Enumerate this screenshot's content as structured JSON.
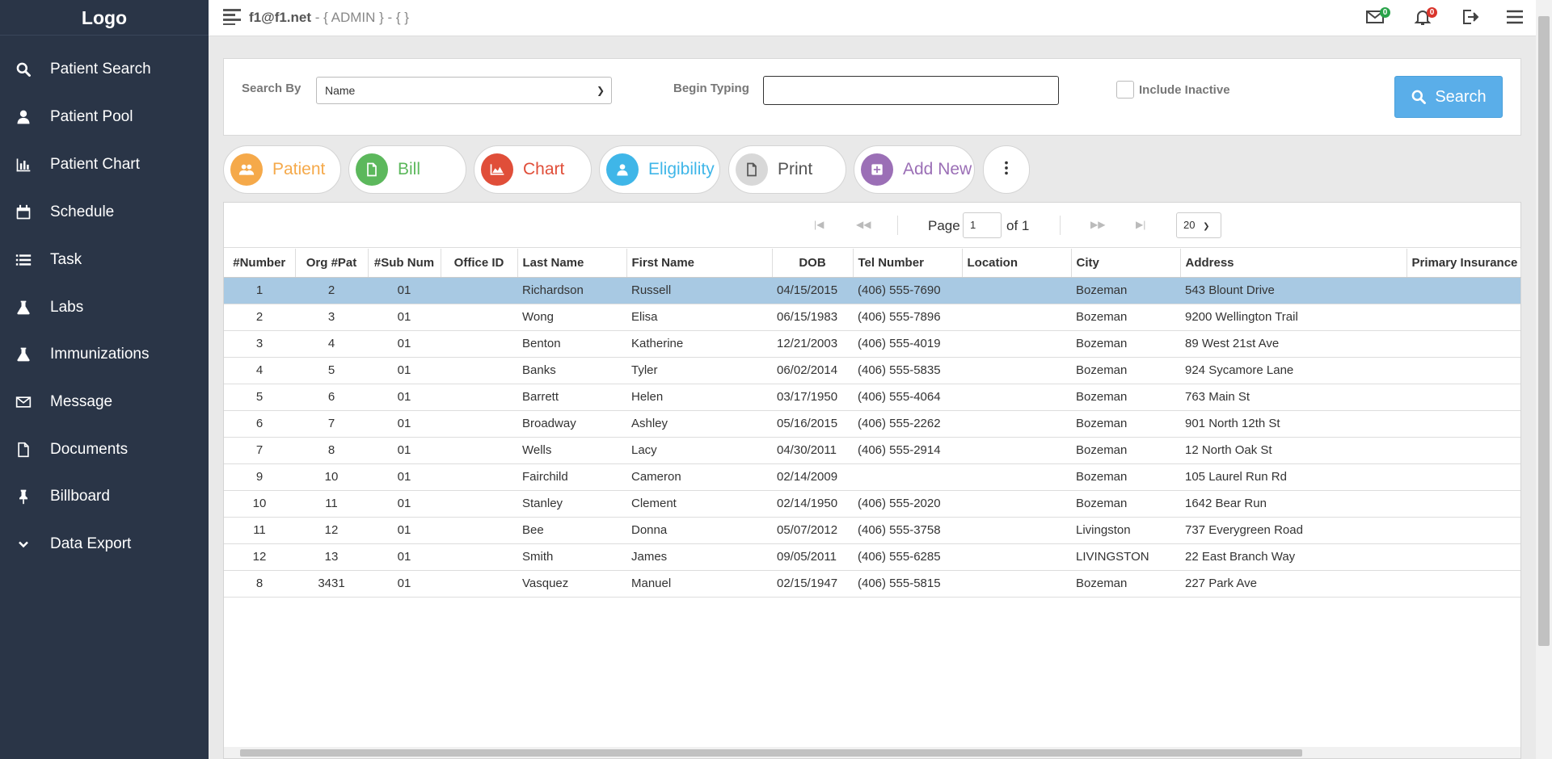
{
  "sidebar": {
    "logo": "Logo",
    "items": [
      {
        "label": "Patient Search",
        "icon": "search-icon"
      },
      {
        "label": "Patient Pool",
        "icon": "user-icon"
      },
      {
        "label": "Patient Chart",
        "icon": "bar-chart-icon"
      },
      {
        "label": "Schedule",
        "icon": "calendar-icon"
      },
      {
        "label": "Task",
        "icon": "list-icon"
      },
      {
        "label": "Labs",
        "icon": "flask-icon"
      },
      {
        "label": "Immunizations",
        "icon": "flask-icon"
      },
      {
        "label": "Message",
        "icon": "envelope-icon"
      },
      {
        "label": "Documents",
        "icon": "document-icon"
      },
      {
        "label": "Billboard",
        "icon": "pin-icon"
      },
      {
        "label": "Data Export",
        "icon": "chevron-down-icon"
      }
    ]
  },
  "topbar": {
    "email": "f1@f1.net",
    "role": "- { ADMIN } - { }",
    "mail_count": "0",
    "notif_count": "0"
  },
  "search": {
    "search_by_label": "Search By",
    "search_by_value": "Name",
    "begin_typing_label": "Begin Typing",
    "begin_typing_value": "",
    "include_inactive_label": "Include Inactive",
    "search_button": "Search"
  },
  "actions": {
    "patient": "Patient",
    "bill": "Bill",
    "chart": "Chart",
    "eligibility": "Eligibility",
    "print": "Print",
    "add_new": "Add New"
  },
  "pager": {
    "page_label": "Page",
    "page_value": "1",
    "of_label": "of 1",
    "page_size": "20"
  },
  "table": {
    "columns": [
      "#Number",
      "Org #Pat",
      "#Sub Num",
      "Office ID",
      "Last Name",
      "First Name",
      "DOB",
      "Tel Number",
      "Location",
      "City",
      "Address",
      "Primary Insurance"
    ],
    "rows": [
      [
        "1",
        "2",
        "01",
        "",
        "Richardson",
        "Russell",
        "04/15/2015",
        "(406) 555-7690",
        "",
        "Bozeman",
        "543 Blount Drive",
        ""
      ],
      [
        "2",
        "3",
        "01",
        "",
        "Wong",
        "Elisa",
        "06/15/1983",
        "(406) 555-7896",
        "",
        "Bozeman",
        "9200 Wellington Trail",
        ""
      ],
      [
        "3",
        "4",
        "01",
        "",
        "Benton",
        "Katherine",
        "12/21/2003",
        "(406) 555-4019",
        "",
        "Bozeman",
        "89 West 21st Ave",
        ""
      ],
      [
        "4",
        "5",
        "01",
        "",
        "Banks",
        "Tyler",
        "06/02/2014",
        "(406) 555-5835",
        "",
        "Bozeman",
        "924 Sycamore Lane",
        ""
      ],
      [
        "5",
        "6",
        "01",
        "",
        "Barrett",
        "Helen",
        "03/17/1950",
        "(406) 555-4064",
        "",
        "Bozeman",
        "763 Main St",
        ""
      ],
      [
        "6",
        "7",
        "01",
        "",
        "Broadway",
        "Ashley",
        "05/16/2015",
        "(406) 555-2262",
        "",
        "Bozeman",
        "901 North 12th St",
        ""
      ],
      [
        "7",
        "8",
        "01",
        "",
        "Wells",
        "Lacy",
        "04/30/2011",
        "(406) 555-2914",
        "",
        "Bozeman",
        "12 North Oak St",
        ""
      ],
      [
        "9",
        "10",
        "01",
        "",
        "Fairchild",
        "Cameron",
        "02/14/2009",
        "",
        "",
        "Bozeman",
        "105 Laurel Run Rd",
        ""
      ],
      [
        "10",
        "11",
        "01",
        "",
        "Stanley",
        "Clement",
        "02/14/1950",
        "(406) 555-2020",
        "",
        "Bozeman",
        "1642 Bear Run",
        ""
      ],
      [
        "11",
        "12",
        "01",
        "",
        "Bee",
        "Donna",
        "05/07/2012",
        "(406) 555-3758",
        "",
        "Livingston",
        "737 Everygreen Road",
        ""
      ],
      [
        "12",
        "13",
        "01",
        "",
        "Smith",
        "James",
        "09/05/2011",
        "(406) 555-6285",
        "",
        "LIVINGSTON",
        "22 East Branch Way",
        ""
      ],
      [
        "8",
        "3431",
        "01",
        "",
        "Vasquez",
        "Manuel",
        "02/15/1947",
        "(406) 555-5815",
        "",
        "Bozeman",
        "227 Park Ave",
        ""
      ]
    ]
  },
  "colors": {
    "sidebar_bg": "#2a3547",
    "patient": "#f5a94a",
    "bill": "#5cb85c",
    "chart": "#e04e39",
    "eligibility": "#3fb6e8",
    "print": "#888888",
    "add_new": "#9b6fb6",
    "selected_row": "#a8c9e3",
    "search_btn": "#5aaee9"
  }
}
